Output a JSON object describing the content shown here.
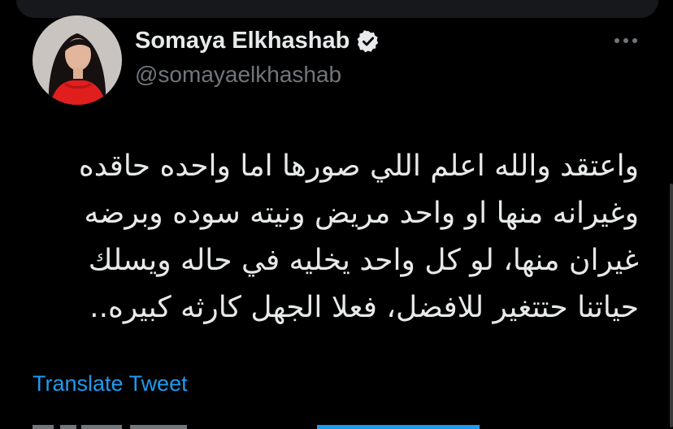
{
  "tweet": {
    "author": {
      "display_name": "Somaya Elkhashab",
      "handle": "@somayaelkhashab",
      "verified": true,
      "verified_icon": "verified-badge-icon",
      "avatar_icon": "profile-avatar"
    },
    "more_icon": "more-options-icon",
    "text_lines": [
      "واعتقد والله اعلم اللي صورها اما واحده حاقده",
      "وغيرانه منها او واحد مريض ونيته سوده وبرضه",
      "غيران منها، لو كل واحد يخليه في حاله ويسلك",
      "حياتنا حتتغير للافضل، فعلا الجهل كارثه كبيره.."
    ],
    "translate_label": "Translate Tweet"
  },
  "colors": {
    "background": "#000000",
    "text": "#e7e9ea",
    "secondary_text": "#71767b",
    "link": "#1d9bf0"
  }
}
